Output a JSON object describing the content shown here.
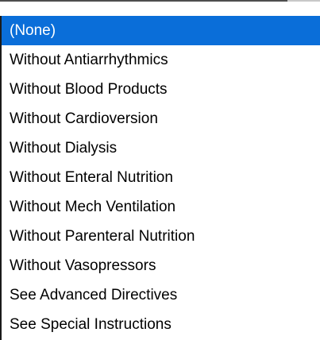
{
  "dropdown": {
    "selected_index": 0,
    "options": [
      "(None)",
      "Without Antiarrhythmics",
      "Without Blood Products",
      "Without Cardioversion",
      "Without Dialysis",
      "Without Enteral Nutrition",
      "Without Mech Ventilation",
      "Without Parenteral Nutrition",
      "Without Vasopressors",
      "See Advanced Directives",
      "See Special Instructions"
    ]
  },
  "colors": {
    "highlight": "#0a6ed9",
    "highlight_text": "#ffffff",
    "text": "#000000",
    "background": "#ffffff"
  }
}
